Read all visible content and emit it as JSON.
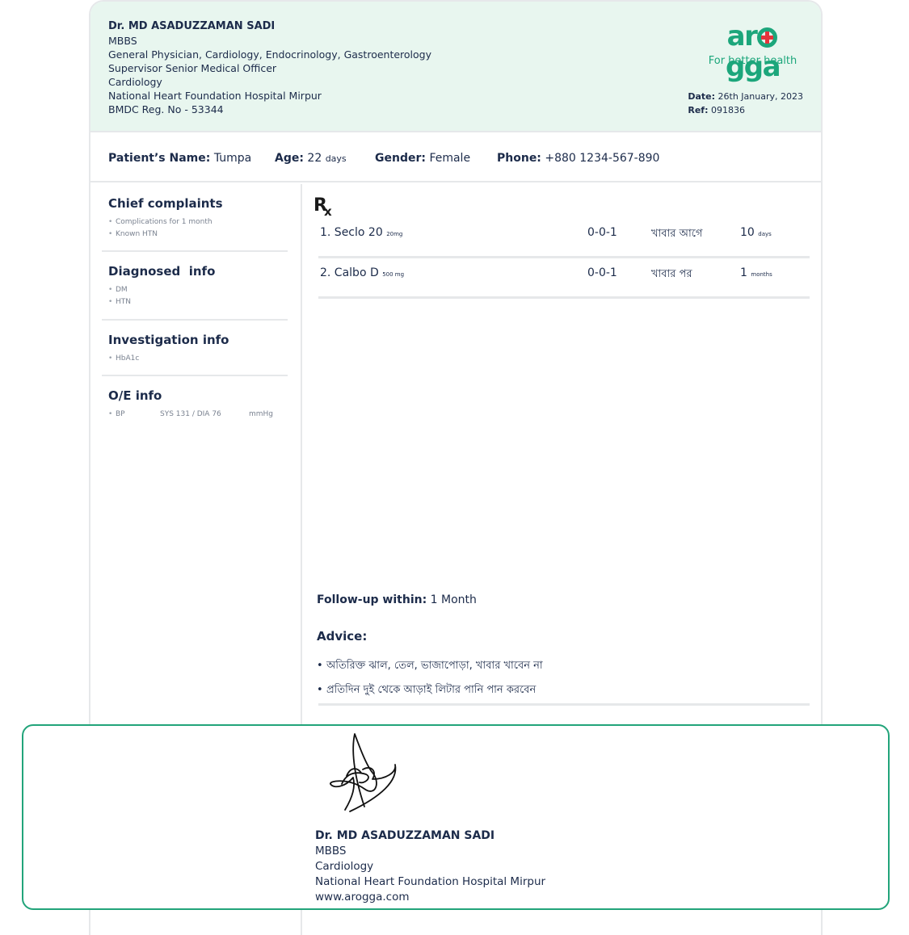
{
  "doctor": {
    "name": "Dr. MD ASADUZZAMAN SADI",
    "lines": [
      "MBBS",
      "General Physician, Cardiology, Endocrinology, Gastroenterology",
      "Supervisor Senior Medical Officer",
      "Cardiology",
      "National Heart Foundation Hospital Mirpur",
      "BMDC Reg. No - 53344"
    ]
  },
  "logo": {
    "word_start": "ar",
    "word_end": "gga",
    "tagline": "For better health",
    "color": "#1ca67b",
    "cross_color": "#e5343c"
  },
  "meta": {
    "date_label": "Date:",
    "date": "26th January, 2023",
    "ref_label": "Ref:",
    "ref": "091836"
  },
  "patient": {
    "name_label": "Patient’s Name:",
    "name": "Tumpa",
    "age_label": "Age:",
    "age": "22",
    "age_unit": "days",
    "gender_label": "Gender:",
    "gender": "Female",
    "phone_label": "Phone:",
    "phone": "+880 1234-567-890"
  },
  "left": {
    "chief": {
      "title": "Chief complaints",
      "items": [
        "Complications for 1 month",
        "Known HTN"
      ]
    },
    "diagnosed": {
      "title": "Diagnosed  info",
      "items": [
        "DM",
        "HTN"
      ]
    },
    "investigation": {
      "title": "Investigation info",
      "items": [
        "HbA1c"
      ]
    },
    "oe": {
      "title": "O/E info",
      "label": "BP",
      "value": "SYS 131 / DIA 76",
      "unit": "mmHg"
    }
  },
  "rx": {
    "symbol_r": "R",
    "symbol_x": "x",
    "medicines": [
      {
        "name": "1. Seclo 20",
        "strength": "20mg",
        "dose": "0-0-1",
        "when": "খাবার আগে",
        "duration": "10",
        "duration_unit": "days"
      },
      {
        "name": "2. Calbo D",
        "strength": "500 mg",
        "dose": "0-0-1",
        "when": "খাবার পর",
        "duration": "1",
        "duration_unit": "months"
      }
    ]
  },
  "follow_up": {
    "label": "Follow-up within:",
    "value": "1 Month"
  },
  "advice": {
    "title": "Advice:",
    "items": [
      "অতিরিক্ত ঝাল, তেল, ভাজাপোড়া, খাবার খাবেন না",
      "প্রতিদিন দুই থেকে আড়াই লিটার পানি পান করবেন"
    ]
  },
  "signature_block": {
    "name": "Dr. MD ASADUZZAMAN SADI",
    "lines": [
      "MBBS",
      "Cardiology",
      "National Heart Foundation Hospital Mirpur",
      "www.arogga.com"
    ]
  }
}
